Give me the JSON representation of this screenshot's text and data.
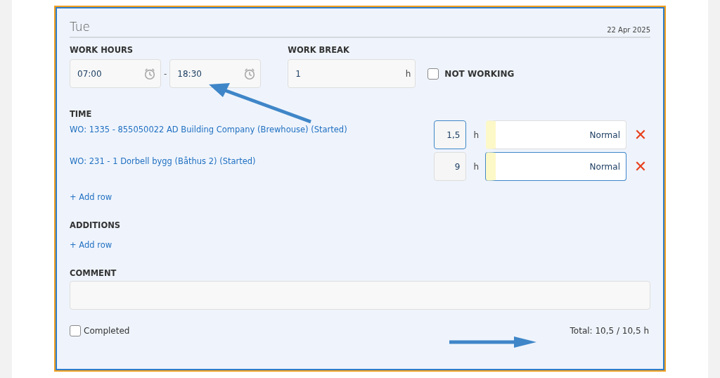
{
  "day": {
    "title": "Tue",
    "date": "22 Apr 2025"
  },
  "work_hours": {
    "label": "WORK HOURS",
    "start": "07:00",
    "separator": "-",
    "end": "18:30"
  },
  "work_break": {
    "label": "WORK BREAK",
    "value": "1",
    "unit": "h"
  },
  "not_working": {
    "label": "NOT WORKING",
    "checked": false
  },
  "time": {
    "label": "TIME",
    "rows": [
      {
        "order": "WO: 1335 - 855050022 AD Building Company (Brewhouse) (Started)",
        "hours": "1,5",
        "unit": "h",
        "hours_focused": true,
        "type": "Normal",
        "type_focused": false,
        "remove": "✕"
      },
      {
        "order": "WO: 231 - 1 Dorbell bygg (Båthus 2) (Started)",
        "hours": "9",
        "unit": "h",
        "hours_focused": false,
        "type": "Normal",
        "type_focused": true,
        "remove": "✕"
      }
    ],
    "add_row": "+ Add row"
  },
  "additions": {
    "label": "ADDITIONS",
    "add_row": "+ Add row"
  },
  "comment": {
    "label": "COMMENT"
  },
  "completed": {
    "label": "Completed",
    "checked": false
  },
  "total": "Total: 10,5 / 10,5 h"
}
